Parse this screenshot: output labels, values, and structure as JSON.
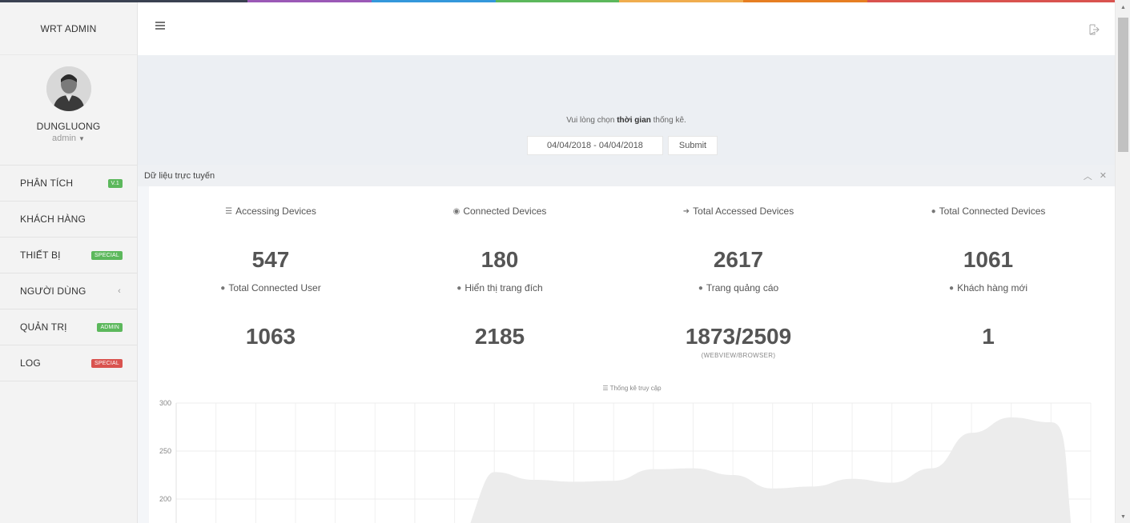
{
  "colors": {
    "rainbow": [
      "#3a4151",
      "#3a4151",
      "#9b59b6",
      "#3498db",
      "#5cb85c",
      "#f0ad4e",
      "#e67e22",
      "#d9534f",
      "#d9534f"
    ],
    "badge_green": "#5cb85c",
    "badge_red": "#d9534f",
    "chart_fill": "#ececec"
  },
  "sidebar": {
    "brand": "WRT ADMIN",
    "user": {
      "name": "DUNGLUONG",
      "role": "admin"
    },
    "items": [
      {
        "label": "PHÂN TÍCH",
        "badge": "V.1",
        "badge_color": "green"
      },
      {
        "label": "KHÁCH HÀNG"
      },
      {
        "label": "THIẾT BỊ",
        "badge": "SPECIAL",
        "badge_color": "green"
      },
      {
        "label": "NGƯỜI DÙNG",
        "icon": "chevron-left-icon"
      },
      {
        "label": "QUẢN TRỊ",
        "badge": "ADMIN",
        "badge_color": "green"
      },
      {
        "label": "LOG",
        "badge": "SPECIAL",
        "badge_color": "red"
      }
    ]
  },
  "topbar": {
    "menu_icon": "hamburger-icon",
    "exit_icon": "sign-out-icon"
  },
  "filter": {
    "text_before": "Vui lòng chọn ",
    "text_bold": "thời gian",
    "text_after": " thống kê.",
    "date_range": "04/04/2018 - 04/04/2018",
    "submit_label": "Submit"
  },
  "panel": {
    "title": "Dữ liệu trực tuyến",
    "collapse_icon": "chevron-up-icon",
    "close_icon": "close-icon"
  },
  "stats": {
    "row1": [
      {
        "icon": "wifi-icon",
        "glyph": "☰",
        "label": "Accessing Devices",
        "value": "547"
      },
      {
        "icon": "eye-icon",
        "glyph": "◉",
        "label": "Connected Devices",
        "value": "180"
      },
      {
        "icon": "sign-in-icon",
        "glyph": "➜",
        "label": "Total Accessed Devices",
        "value": "2617"
      },
      {
        "icon": "globe-icon",
        "glyph": "●",
        "label": "Total Connected Devices",
        "value": "1061"
      }
    ],
    "row2": [
      {
        "icon": "globe-icon",
        "glyph": "●",
        "label": "Total Connected User",
        "value": "1063"
      },
      {
        "icon": "globe-icon",
        "glyph": "●",
        "label": "Hiển thị trang đích",
        "value": "2185"
      },
      {
        "icon": "globe-icon",
        "glyph": "●",
        "label": "Trang quảng cáo",
        "value": "1873/2509",
        "sub": "(WEBVIEW/BROWSER)"
      },
      {
        "icon": "globe-icon",
        "glyph": "●",
        "label": "Khách hàng mới",
        "value": "1"
      }
    ]
  },
  "chart_data": {
    "type": "area",
    "title": "Thống kê truy cập",
    "title_icon": "wifi-icon",
    "y_ticks": [
      300,
      250,
      200
    ],
    "ylim": [
      170,
      300
    ],
    "grid": true,
    "x": [
      0,
      1,
      2,
      3,
      4,
      5,
      6,
      7,
      8,
      9,
      10,
      11,
      12,
      13,
      14,
      15,
      16,
      17,
      18,
      19,
      20,
      21,
      22,
      23
    ],
    "values": [
      null,
      null,
      null,
      null,
      null,
      null,
      null,
      null,
      228,
      220,
      218,
      219,
      231,
      232,
      225,
      211,
      213,
      221,
      217,
      232,
      269,
      285,
      280,
      null
    ]
  }
}
